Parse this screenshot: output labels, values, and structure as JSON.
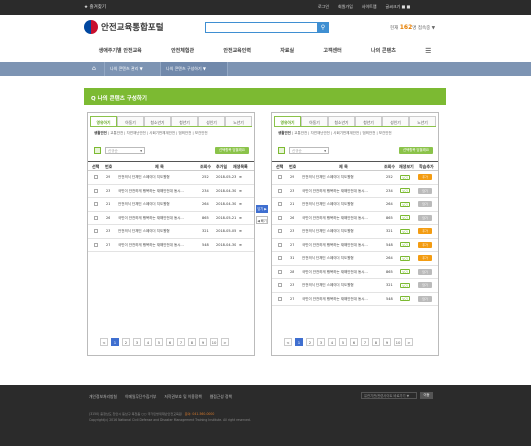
{
  "topbar": {
    "favorite": "★ 즐겨찾기",
    "links": [
      "로그인",
      "회원가입",
      "사이트맵",
      "글씨크기 ■ ■"
    ]
  },
  "logo": {
    "text": "안전교육통합포털"
  },
  "search": {
    "placeholder": "",
    "icon": "search-icon"
  },
  "visitor": {
    "prefix": "현재",
    "count": "162",
    "suffix": "명 접속중 ▼"
  },
  "gnb": {
    "items": [
      "생애주기별 안전교육",
      "안전체험관",
      "안전교육인력",
      "자료실",
      "고객센터",
      "나의 콘텐츠"
    ],
    "menu_icon": "☰"
  },
  "breadcrumb": {
    "home": "⌂",
    "items": [
      "나의 콘텐츠 관리 ▼",
      "나의 콘텐츠 구성하기 ▼"
    ]
  },
  "section": {
    "title": "Q 나의 콘텐츠 구성하기"
  },
  "tabs": [
    "영유아기",
    "아동기",
    "청소년기",
    "청년기",
    "성인기",
    "노년기"
  ],
  "subfilter": {
    "active": "생활안전",
    "rest": " | 교통안전 | 자연재난안전 | 사회기반체계안전 | 범죄안전 | 보건안전"
  },
  "controls": {
    "select_value": "신규순",
    "button": "선택항목 담을래요"
  },
  "left_table": {
    "headers": [
      "선택",
      "번호",
      "제 목",
      "조회수",
      "추가일",
      "재생목록"
    ],
    "rows": [
      {
        "no": "29",
        "title": "안전의식 단체인 스페이더 지도원형",
        "views": "252",
        "date": "2018-05-23",
        "icon": "≡"
      },
      {
        "no": "23",
        "title": "국민이 안전하게 행복하는 재해안전대 동시...",
        "views": "234",
        "date": "2018-04-30",
        "icon": "≡"
      },
      {
        "no": "21",
        "title": "안전의식 단체인 스페이더 지도원형",
        "views": "264",
        "date": "2018-04-30",
        "icon": "≡"
      },
      {
        "no": "26",
        "title": "국민이 안전하게 행복하는 재해안전대 동시...",
        "views": "865",
        "date": "2018-05-21",
        "icon": "≡"
      },
      {
        "no": "23",
        "title": "안전의식 단체인 스페이더 지도원형",
        "views": "321",
        "date": "2018-05-05",
        "icon": "≡"
      },
      {
        "no": "27",
        "title": "국민이 안전하게 행복하는 재해안전대 동시...",
        "views": "548",
        "date": "2018-04-30",
        "icon": "≡"
      }
    ]
  },
  "right_table": {
    "headers": [
      "선택",
      "번호",
      "제 목",
      "조회수",
      "재생보기",
      "학습추가"
    ],
    "rows": [
      {
        "no": "29",
        "title": "안전의식 단체인 스페이더 지도원형",
        "views": "252",
        "tag": "보기",
        "pill": "추가",
        "pill_on": true
      },
      {
        "no": "23",
        "title": "국민이 안전하게 행복하는 재해안전대 동시...",
        "views": "234",
        "tag": "보기",
        "pill": "담기",
        "pill_on": false
      },
      {
        "no": "21",
        "title": "안전의식 단체인 스페이더 지도원형",
        "views": "264",
        "tag": "보기",
        "pill": "담기",
        "pill_on": false
      },
      {
        "no": "26",
        "title": "국민이 안전하게 행복하는 재해안전대 동시...",
        "views": "865",
        "tag": "보기",
        "pill": "담기",
        "pill_on": false
      },
      {
        "no": "23",
        "title": "안전의식 단체인 스페이더 지도원형",
        "views": "321",
        "tag": "보기",
        "pill": "추가",
        "pill_on": true
      },
      {
        "no": "27",
        "title": "국민이 안전하게 행복하는 재해안전대 동시...",
        "views": "548",
        "tag": "보기",
        "pill": "추가",
        "pill_on": true
      },
      {
        "no": "31",
        "title": "안전의식 단체인 스페이더 지도원형",
        "views": "264",
        "tag": "보기",
        "pill": "추가",
        "pill_on": true
      },
      {
        "no": "28",
        "title": "국민이 안전하게 행복하는 재해안전대 동시...",
        "views": "865",
        "tag": "보기",
        "pill": "담기",
        "pill_on": false
      },
      {
        "no": "23",
        "title": "안전의식 단체인 스페이더 지도원형",
        "views": "321",
        "tag": "보기",
        "pill": "담기",
        "pill_on": false
      },
      {
        "no": "27",
        "title": "국민이 안전하게 행복하는 재해안전대 동시...",
        "views": "548",
        "tag": "보기",
        "pill": "담기",
        "pill_on": false
      }
    ]
  },
  "pagination": {
    "prev": "<",
    "pages": [
      "1",
      "2",
      "3",
      "4",
      "5",
      "6",
      "7",
      "8",
      "9",
      "10"
    ],
    "next": ">",
    "current": "1"
  },
  "middle": {
    "add": "담기 ▶",
    "remove": "◀ 빼기"
  },
  "footer": {
    "links": [
      "개인정보처리방침",
      "이메일무단수집거부",
      "저작권보호 및 이용정책",
      "웹접근성 정책"
    ],
    "select": "유관기관/관련사이트 바로가기 ▼",
    "go": "이동",
    "address": "(3150) 충청남도 천안시 동남구 목천읍 ○○ 국가민방위재난안전교육원",
    "phone": "문의: 041-560-0000",
    "copyright": "Copyright(c) 2016 National Civil Defense and Disaster Management Training Institute. All right reserved."
  },
  "colors": {
    "accent_green": "#7cba32",
    "breadcrumb": "#7d94b3",
    "brand_blue": "#3f8fd2",
    "pager_active": "#3f6fd0",
    "pill_orange": "#f39c12"
  }
}
